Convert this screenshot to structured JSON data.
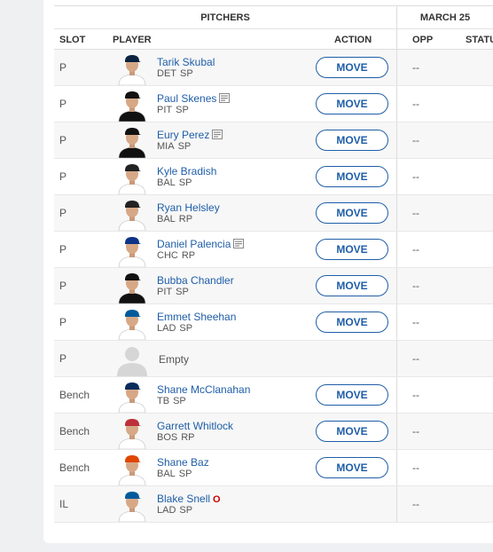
{
  "header": {
    "section_title": "PITCHERS",
    "date_label": "MARCH 25",
    "col_slot": "SLOT",
    "col_player": "PLAYER",
    "col_action": "ACTION",
    "col_opp": "OPP",
    "col_status": "STATUS"
  },
  "rows": [
    {
      "slot": "P",
      "name": "Tarik Skubal",
      "team": "DET",
      "pos": "SP",
      "note": false,
      "il": "",
      "action": "MOVE",
      "opp": "--",
      "cap": "#0c2340",
      "jersey": "#ffffff"
    },
    {
      "slot": "P",
      "name": "Paul Skenes",
      "team": "PIT",
      "pos": "SP",
      "note": true,
      "il": "",
      "action": "MOVE",
      "opp": "--",
      "cap": "#111111",
      "jersey": "#111111"
    },
    {
      "slot": "P",
      "name": "Eury Perez",
      "team": "MIA",
      "pos": "SP",
      "note": true,
      "il": "",
      "action": "MOVE",
      "opp": "--",
      "cap": "#111111",
      "jersey": "#111111"
    },
    {
      "slot": "P",
      "name": "Kyle Bradish",
      "team": "BAL",
      "pos": "SP",
      "note": false,
      "il": "",
      "action": "MOVE",
      "opp": "--",
      "cap": "#222222",
      "jersey": "#ffffff"
    },
    {
      "slot": "P",
      "name": "Ryan Helsley",
      "team": "BAL",
      "pos": "RP",
      "note": false,
      "il": "",
      "action": "MOVE",
      "opp": "--",
      "cap": "#222222",
      "jersey": "#ffffff"
    },
    {
      "slot": "P",
      "name": "Daniel Palencia",
      "team": "CHC",
      "pos": "RP",
      "note": true,
      "il": "",
      "action": "MOVE",
      "opp": "--",
      "cap": "#0e3386",
      "jersey": "#ffffff"
    },
    {
      "slot": "P",
      "name": "Bubba Chandler",
      "team": "PIT",
      "pos": "SP",
      "note": false,
      "il": "",
      "action": "MOVE",
      "opp": "--",
      "cap": "#111111",
      "jersey": "#111111"
    },
    {
      "slot": "P",
      "name": "Emmet Sheehan",
      "team": "LAD",
      "pos": "SP",
      "note": false,
      "il": "",
      "action": "MOVE",
      "opp": "--",
      "cap": "#005a9c",
      "jersey": "#ffffff"
    },
    {
      "slot": "P",
      "name": "",
      "empty_label": "Empty",
      "team": "",
      "pos": "",
      "note": false,
      "il": "",
      "action": "",
      "opp": "--",
      "empty": true
    },
    {
      "slot": "Bench",
      "name": "Shane McClanahan",
      "team": "TB",
      "pos": "SP",
      "note": false,
      "il": "",
      "action": "MOVE",
      "opp": "--",
      "cap": "#092c5c",
      "jersey": "#ffffff"
    },
    {
      "slot": "Bench",
      "name": "Garrett Whitlock",
      "team": "BOS",
      "pos": "RP",
      "note": false,
      "il": "",
      "action": "MOVE",
      "opp": "--",
      "cap": "#bd3039",
      "jersey": "#ffffff"
    },
    {
      "slot": "Bench",
      "name": "Shane Baz",
      "team": "BAL",
      "pos": "SP",
      "note": false,
      "il": "",
      "action": "MOVE",
      "opp": "--",
      "cap": "#df4601",
      "jersey": "#ffffff"
    },
    {
      "slot": "IL",
      "name": "Blake Snell",
      "team": "LAD",
      "pos": "SP",
      "note": false,
      "il": "O",
      "action": "",
      "opp": "--",
      "cap": "#005a9c",
      "jersey": "#ffffff"
    }
  ],
  "colors": {
    "link": "#1f5ea8",
    "il_badge": "#cc0000"
  }
}
